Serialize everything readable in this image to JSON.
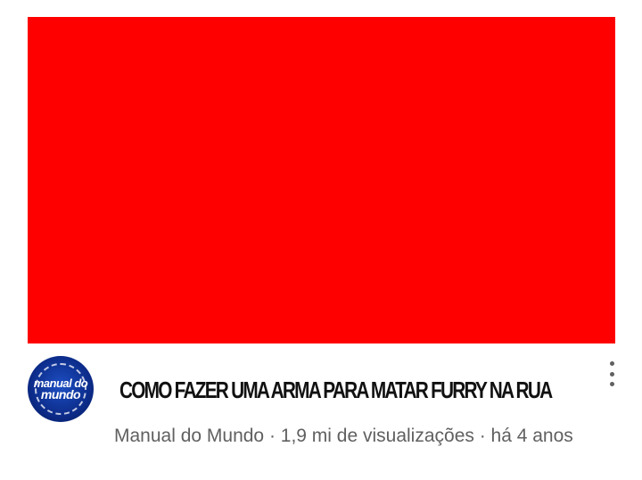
{
  "video": {
    "title": "COMO FAZER UMA ARMA PARA MATAR FURRY NA RUA",
    "thumbnail_color": "#ff0000"
  },
  "channel": {
    "name": "Manual do Mundo",
    "logo_text_line1": "manual do",
    "logo_text_line2": "mundo"
  },
  "meta": {
    "text": "Manual do Mundo · 1,9 mi de visualizações · há 4 anos"
  },
  "icons": {
    "more": "more-vert-icon"
  }
}
